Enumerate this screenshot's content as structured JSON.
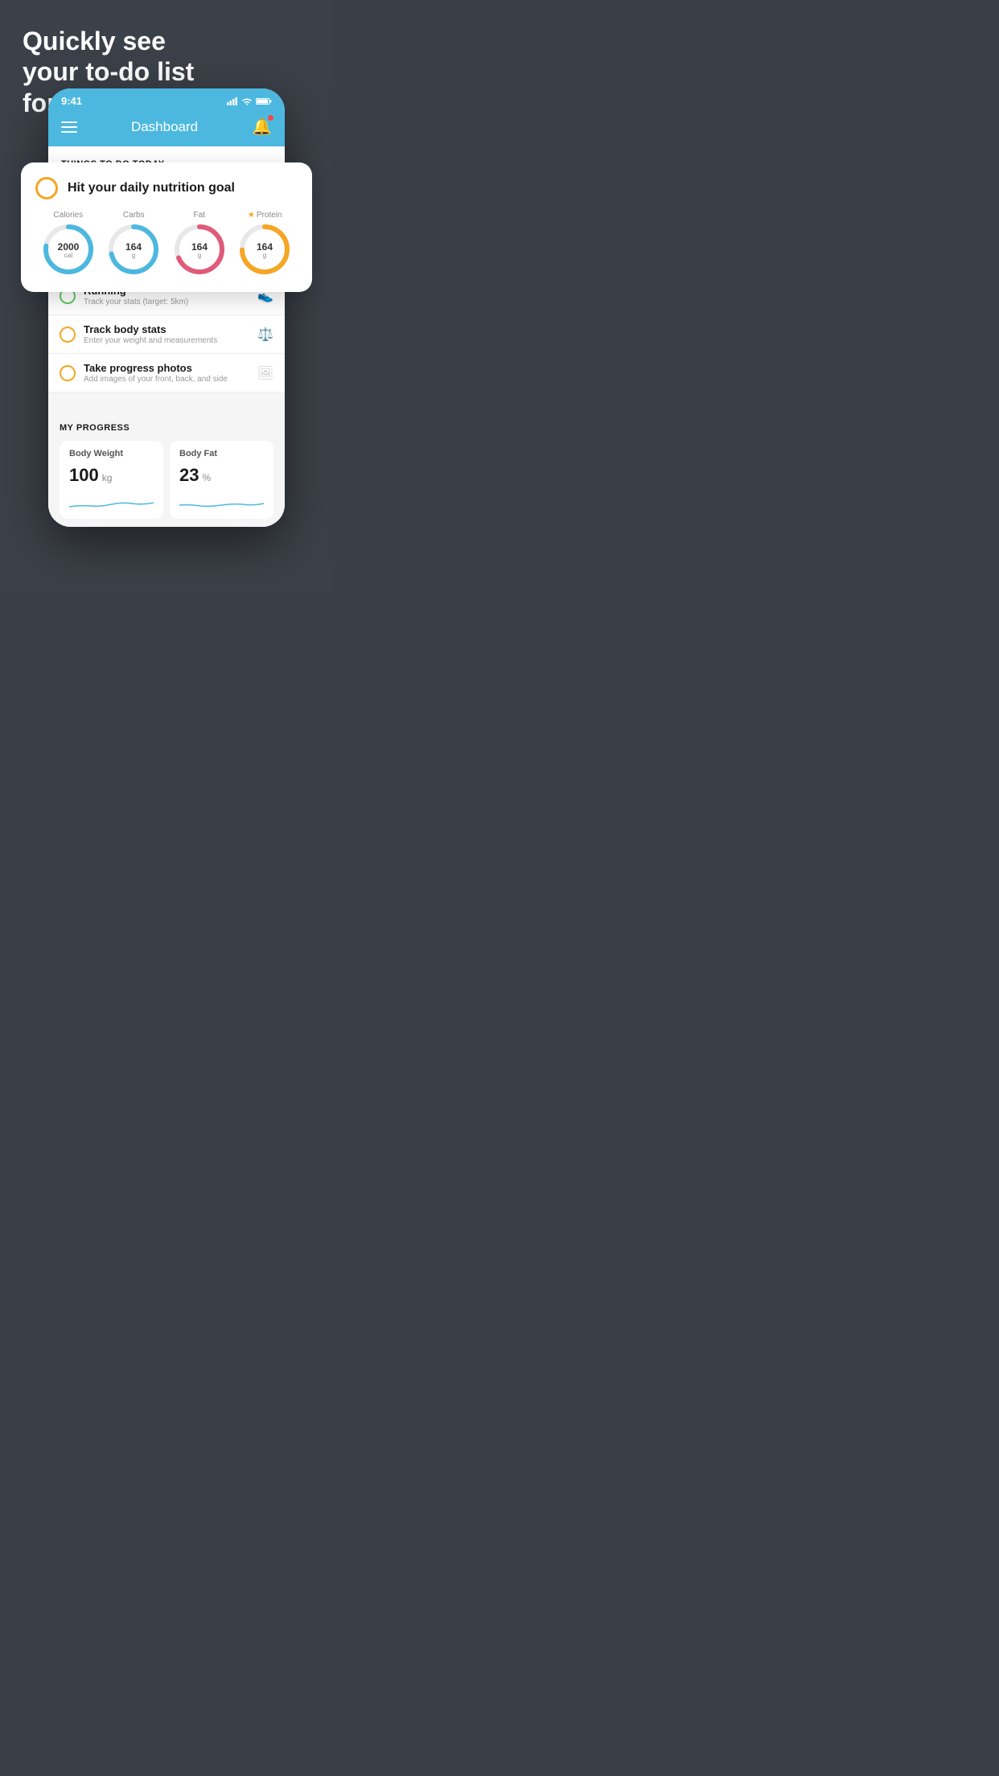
{
  "headline": {
    "line1": "Quickly see",
    "line2": "your to-do list",
    "line3": "for the day."
  },
  "status_bar": {
    "time": "9:41",
    "signal": "signal-icon",
    "wifi": "wifi-icon",
    "battery": "battery-icon"
  },
  "nav": {
    "title": "Dashboard",
    "menu_icon": "hamburger-icon",
    "bell_icon": "bell-icon"
  },
  "section_header": {
    "label": "THINGS TO DO TODAY"
  },
  "floating_card": {
    "title": "Hit your daily nutrition goal",
    "items": [
      {
        "label": "Calories",
        "value": "2000",
        "unit": "cal",
        "color": "#4cb8e0",
        "starred": false
      },
      {
        "label": "Carbs",
        "value": "164",
        "unit": "g",
        "color": "#4cb8e0",
        "starred": false
      },
      {
        "label": "Fat",
        "value": "164",
        "unit": "g",
        "color": "#e05a7a",
        "starred": false
      },
      {
        "label": "Protein",
        "value": "164",
        "unit": "g",
        "color": "#f5a623",
        "starred": true
      }
    ]
  },
  "todo_items": [
    {
      "label": "Running",
      "sublabel": "Track your stats (target: 5km)",
      "circle_color": "green",
      "icon": "shoe-icon"
    },
    {
      "label": "Track body stats",
      "sublabel": "Enter your weight and measurements",
      "circle_color": "yellow",
      "icon": "scale-icon"
    },
    {
      "label": "Take progress photos",
      "sublabel": "Add images of your front, back, and side",
      "circle_color": "yellow",
      "icon": "photo-icon"
    }
  ],
  "progress": {
    "section_title": "MY PROGRESS",
    "cards": [
      {
        "title": "Body Weight",
        "value": "100",
        "unit": "kg"
      },
      {
        "title": "Body Fat",
        "value": "23",
        "unit": "%"
      }
    ]
  }
}
